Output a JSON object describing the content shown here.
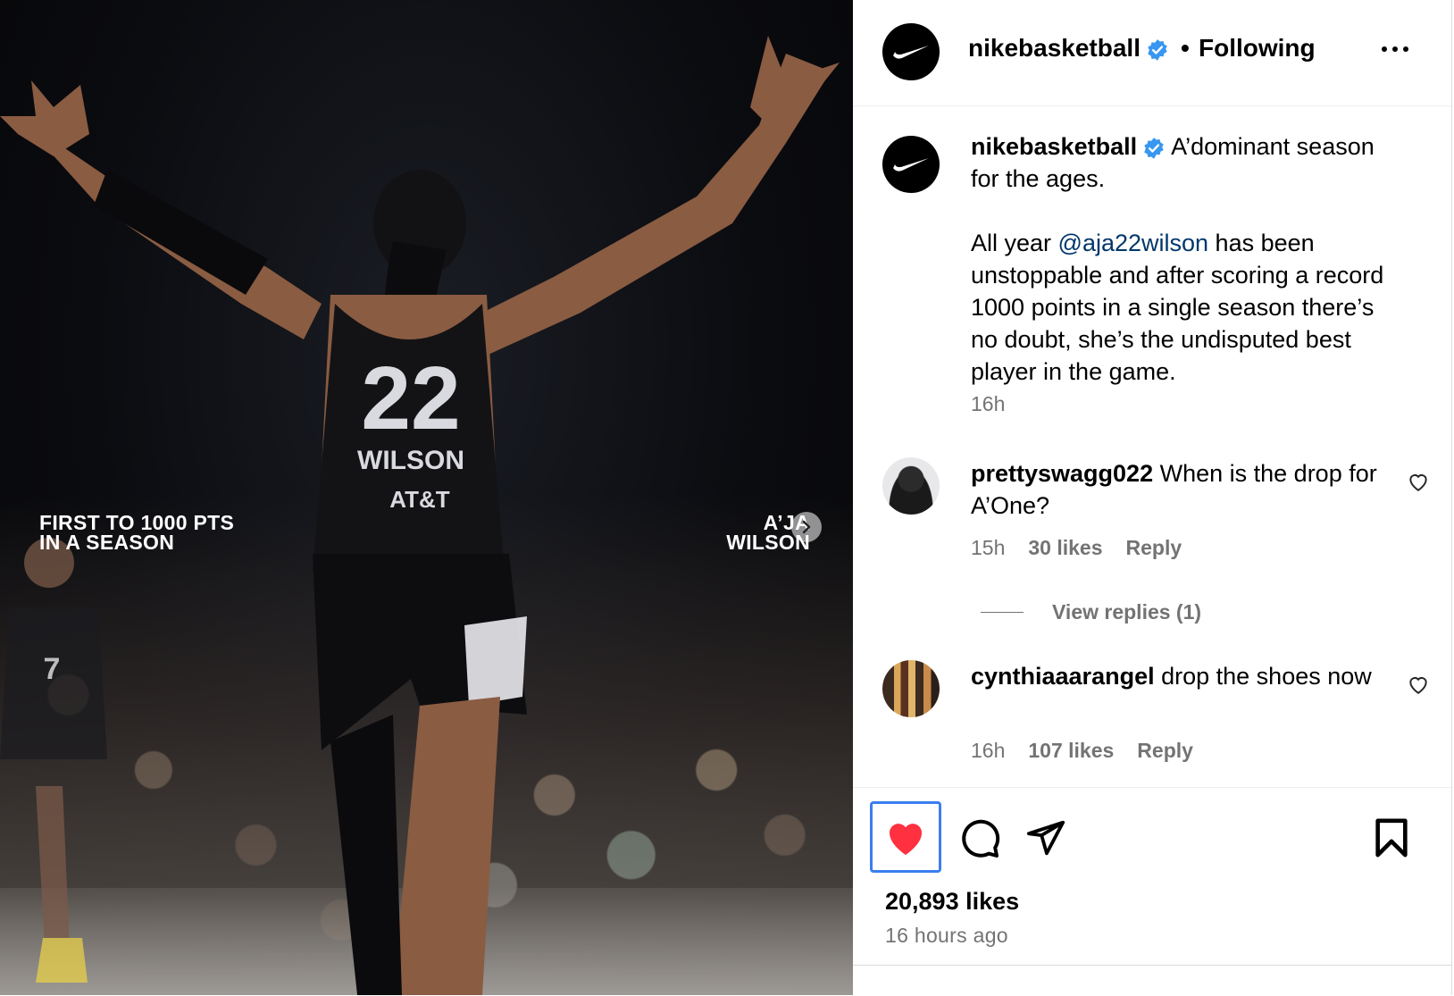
{
  "post": {
    "image": {
      "overlay_left": "FIRST TO 1000 PTS\nIN A SEASON",
      "overlay_right": "A’JA\nWILSON",
      "jersey_number": "22",
      "jersey_name": "WILSON",
      "jersey_sponsor": "AT&T",
      "bg_player_number": "7"
    },
    "next_icon": "chevron-right-icon"
  },
  "header": {
    "username": "nikebasketball",
    "separator": "•",
    "follow_status": "Following",
    "verified_icon": "verified-badge-icon",
    "more_icon": "more-horizontal-icon"
  },
  "caption": {
    "username": "nikebasketball",
    "line1": "A’dominant season for the ages.",
    "body_pre": "All year ",
    "mention": "@aja22wilson",
    "body_post": " has been unstoppable and after scoring a record 1000 points in a single season there’s no doubt, she’s the undisputed best player in the game.",
    "time": "16h"
  },
  "comments": [
    {
      "username": "prettyswagg022",
      "text": "When is the drop for A’One?",
      "time": "15h",
      "likes": "30 likes",
      "reply": "Reply",
      "view_replies": "View replies (1)"
    },
    {
      "username": "cynthiaaarangel",
      "text": "drop the shoes now",
      "time": "16h",
      "likes": "107 likes",
      "reply": "Reply"
    }
  ],
  "actions": {
    "like_icon": "heart-filled-icon",
    "comment_icon": "comment-icon",
    "share_icon": "send-icon",
    "save_icon": "bookmark-icon",
    "likes_count": "20,893 likes",
    "posted_ago": "16 hours ago"
  },
  "colors": {
    "like_red": "#ff3040",
    "verified_blue": "#3897f0",
    "mention_blue": "#00376b",
    "muted_gray": "#737373",
    "focus_blue": "#3a7ef0"
  }
}
